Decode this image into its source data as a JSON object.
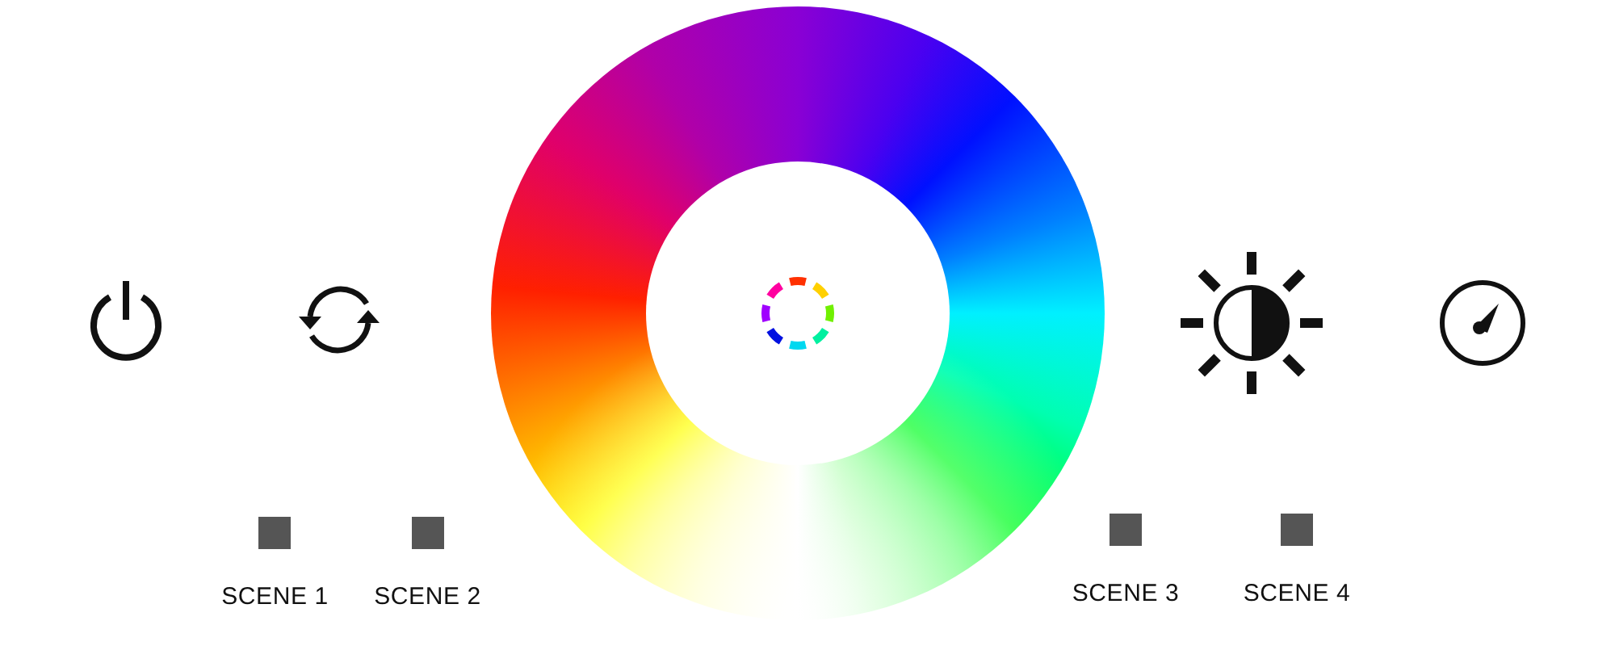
{
  "scenes": [
    {
      "label": "SCENE 1"
    },
    {
      "label": "SCENE 2"
    },
    {
      "label": "SCENE 3"
    },
    {
      "label": "SCENE 4"
    }
  ]
}
